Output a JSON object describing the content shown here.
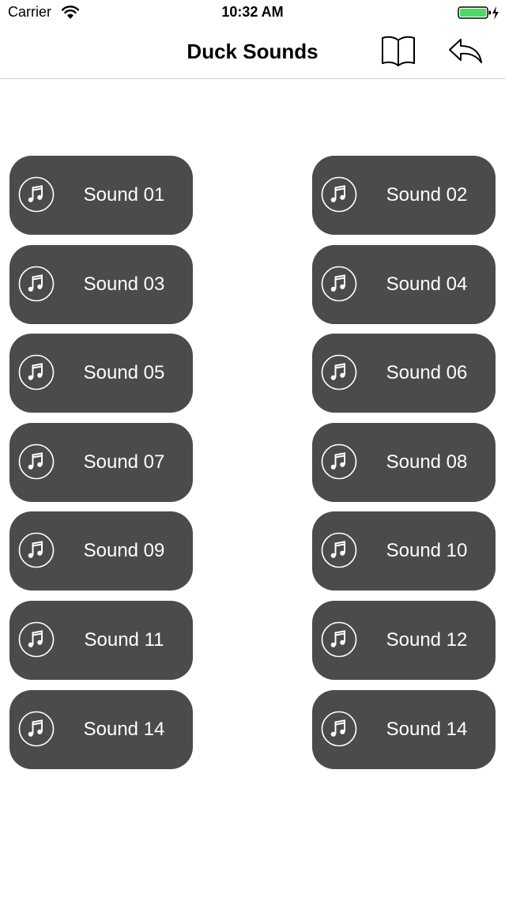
{
  "status_bar": {
    "carrier": "Carrier",
    "time": "10:32 AM",
    "wifi_icon": "wifi-icon",
    "battery_icon": "battery-charging-icon",
    "battery_color": "#4cd964"
  },
  "nav": {
    "title": "Duck Sounds",
    "book_icon": "book-icon",
    "share_icon": "reply-arrow-icon"
  },
  "sounds": [
    {
      "label": "Sound 01"
    },
    {
      "label": "Sound 02"
    },
    {
      "label": "Sound 03"
    },
    {
      "label": "Sound 04"
    },
    {
      "label": "Sound 05"
    },
    {
      "label": "Sound 06"
    },
    {
      "label": "Sound 07"
    },
    {
      "label": "Sound 08"
    },
    {
      "label": "Sound 09"
    },
    {
      "label": "Sound 10"
    },
    {
      "label": "Sound 11"
    },
    {
      "label": "Sound 12"
    },
    {
      "label": "Sound 14"
    },
    {
      "label": "Sound 14"
    }
  ],
  "button_icon": "music-note-icon",
  "colors": {
    "button_bg": "#4b4a4c",
    "button_text": "#ffffff"
  }
}
